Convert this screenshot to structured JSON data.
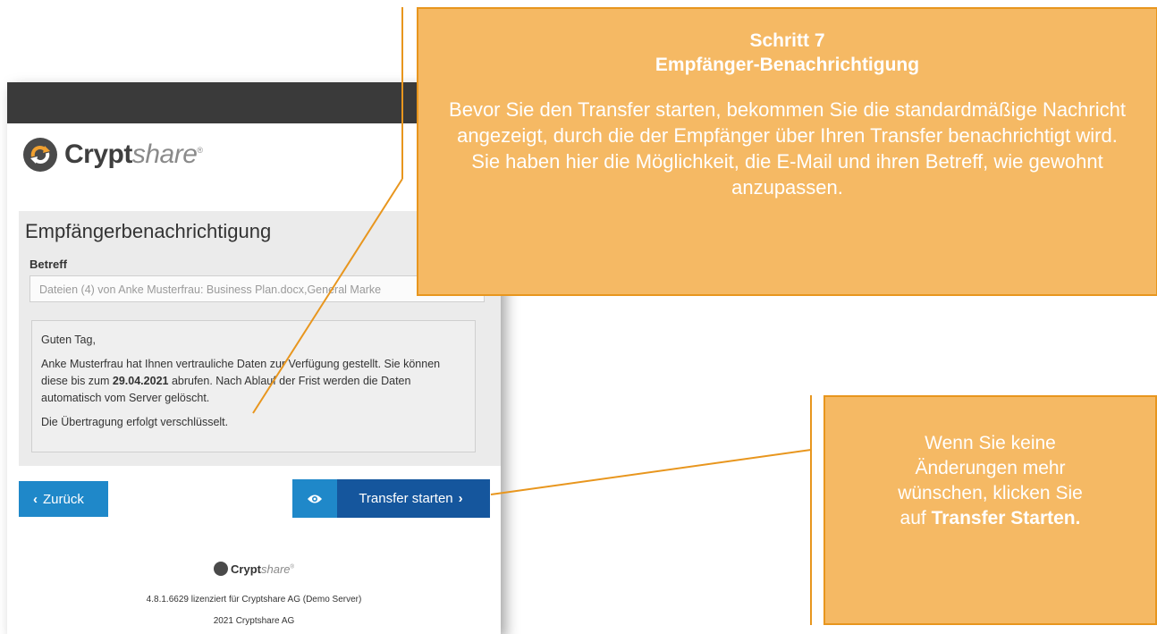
{
  "app": {
    "brand_bold": "Crypt",
    "brand_italic": "share",
    "brand_mark": "®"
  },
  "panel": {
    "title": "Empfängerbenachrichtigung",
    "subject_label": "Betreff",
    "subject_value": "Dateien (4) von Anke Musterfrau: Business Plan.docx,General Marke",
    "message": {
      "greeting": "Guten Tag,",
      "line1_pre": "Anke Musterfrau hat Ihnen vertrauliche Daten zur Verfügung gestellt. Sie können diese bis zum ",
      "date": "29.04.2021",
      "line1_post": " abrufen. Nach Ablauf der Frist werden die Daten automatisch vom Server gelöscht.",
      "line2": "Die Übertragung erfolgt verschlüsselt."
    }
  },
  "buttons": {
    "back": "Zurück",
    "transfer": "Transfer starten"
  },
  "footer": {
    "version": "4.8.1.6629 lizenziert für Cryptshare AG (Demo Server)",
    "copyright": "2021 Cryptshare AG"
  },
  "callouts": {
    "top_title_1": "Schritt 7",
    "top_title_2": "Empfänger-Benachrichtigung",
    "top_body": "Bevor Sie den Transfer starten, bekommen Sie die standardmäßige Nachricht angezeigt, durch die der Empfänger über Ihren Transfer benachrichtigt wird. Sie haben hier die Möglichkeit, die E-Mail und ihren Betreff, wie gewohnt anzupassen.",
    "right_body_pre": "Wenn Sie keine Änderungen mehr wünschen, klicken Sie auf ",
    "right_body_bold": "Transfer Starten."
  },
  "colors": {
    "callout_fill": "#f5b964",
    "callout_border": "#e8961e",
    "button_primary": "#1f88c9",
    "button_dark": "#15569d",
    "topbar": "#3a3a3a"
  }
}
